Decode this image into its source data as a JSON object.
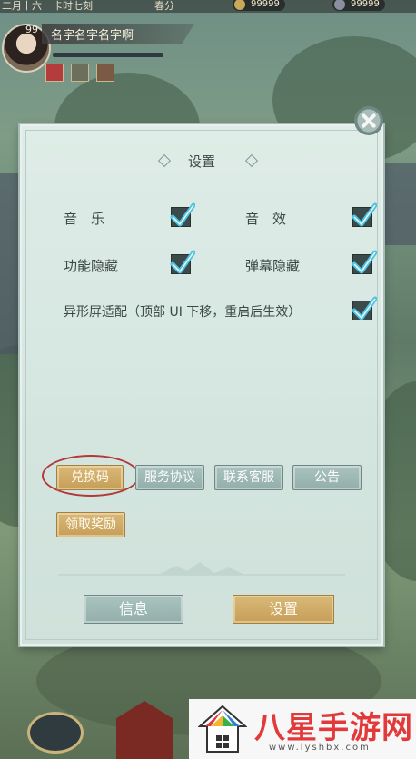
{
  "hud": {
    "top_left_text": "二月十六",
    "top_mid_text": "卡时七刻",
    "top_mid2_text": "春分",
    "currency1": "99999",
    "currency2": "99999",
    "level": "99",
    "player_name": "名字名字名字啊",
    "exp_progress": 0.0
  },
  "dialog": {
    "title": "设置",
    "options": [
      {
        "label": "音　乐",
        "checked": true
      },
      {
        "label": "音　效",
        "checked": true
      },
      {
        "label": "功能隐藏",
        "checked": true
      },
      {
        "label": "弹幕隐藏",
        "checked": true
      },
      {
        "label": "异形屏适配（顶部 UI 下移，重启后生效）",
        "checked": true
      }
    ],
    "buttons": {
      "redeem_code": "兑换码",
      "service_agreement": "服务协议",
      "contact_support": "联系客服",
      "announcement": "公告",
      "claim_reward": "领取奖励"
    },
    "tabs": {
      "info": "信息",
      "settings": "设置"
    }
  },
  "watermark": {
    "text": "八星手游网",
    "url": "www.lyshbx.com"
  },
  "colors": {
    "gold_button": "#c69e58",
    "teal_button": "#93aeaa",
    "checkmark": "#4fc3e0",
    "highlight_ring": "#b4373a"
  }
}
